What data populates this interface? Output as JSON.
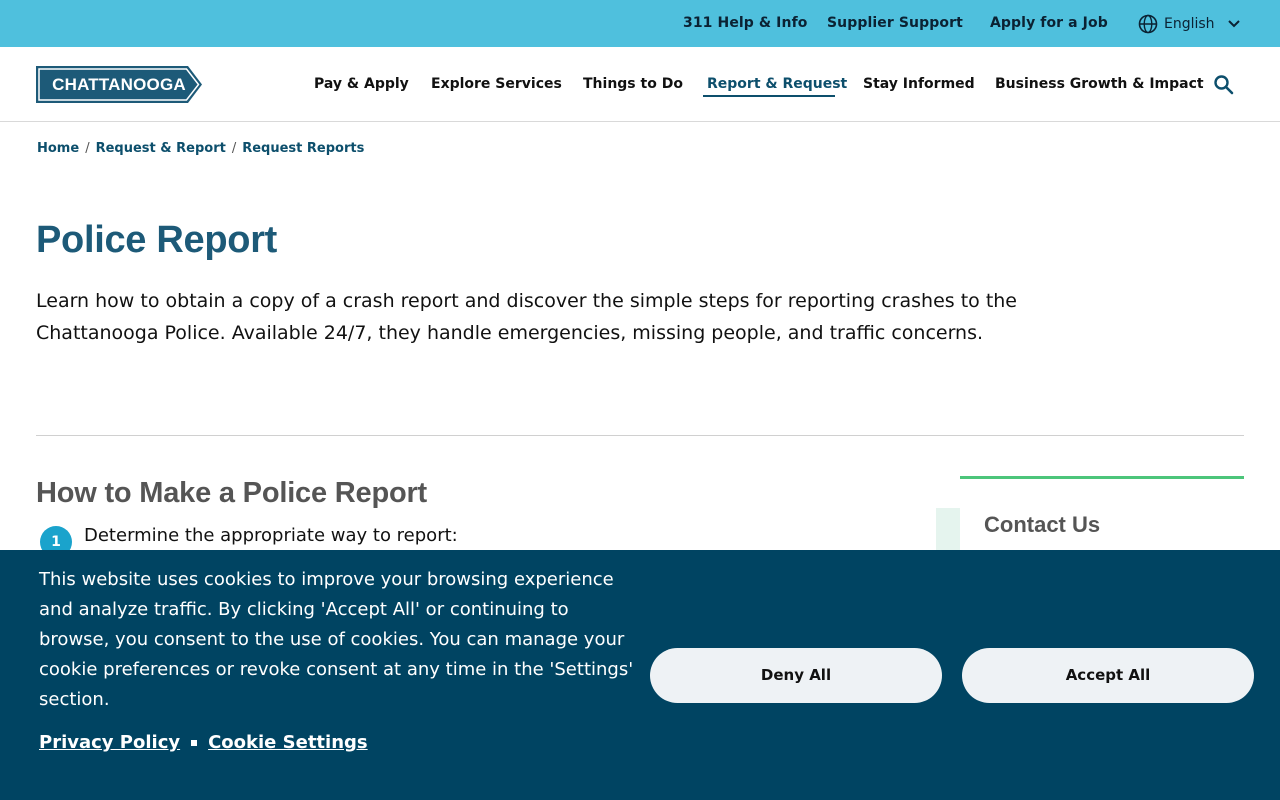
{
  "utility_nav": {
    "links": [
      "311 Help & Info",
      "Supplier Support",
      "Apply for a Job"
    ],
    "language": "English"
  },
  "header": {
    "logo_text": "CHATTANOOGA",
    "nav": [
      "Pay & Apply",
      "Explore Services",
      "Things to Do",
      "Report & Request",
      "Stay Informed",
      "Business Growth & Impact"
    ],
    "active_nav": "Report & Request"
  },
  "breadcrumb": [
    "Home",
    "Request & Report",
    "Request Reports"
  ],
  "main": {
    "title": "Police Report",
    "intro": "Learn how to obtain a copy of a crash report and discover the simple steps for reporting crashes to the Chattanooga Police. Available 24/7, they handle emergencies, missing people, and traffic concerns.",
    "section_title": "How to Make a Police Report",
    "steps": [
      {
        "number": "1",
        "text": "Determine the appropriate way to report:"
      }
    ]
  },
  "sidebar": {
    "contact_title": "Contact Us"
  },
  "cookie_banner": {
    "text": "This website uses cookies to improve your browsing experience and analyze traffic. By clicking 'Accept All' or continuing to browse, you consent to the use of cookies. You can manage your cookie preferences or revoke consent at any time in the 'Settings' section.",
    "privacy_link": "Privacy Policy",
    "settings_link": "Cookie Settings",
    "deny_label": "Deny All",
    "accept_label": "Accept All"
  },
  "colors": {
    "utility_bar": "#4fc0dd",
    "brand_dark": "#1d5a78",
    "banner_bg": "#004462",
    "step_circle": "#1aa3cc",
    "sidebar_accent": "#4cc57a"
  },
  "icons": {
    "language": "globe-icon",
    "dropdown": "chevron-down-icon",
    "search": "search-icon"
  }
}
